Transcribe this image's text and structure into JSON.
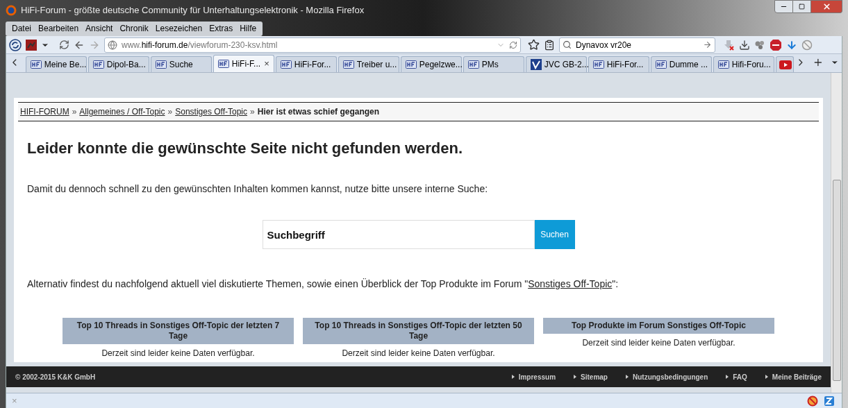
{
  "window": {
    "title": "HiFi-Forum - größte deutsche Community für Unterhaltungselektronik - Mozilla Firefox"
  },
  "menu": [
    "Datei",
    "Bearbeiten",
    "Ansicht",
    "Chronik",
    "Lesezeichen",
    "Extras",
    "Hilfe"
  ],
  "address": {
    "domain_prefix": "www.",
    "domain": "hifi-forum.de",
    "path": "/viewforum-230-ksv.html"
  },
  "search": {
    "value": "Dynavox vr20e"
  },
  "tabs": [
    {
      "label": "Meine Be...",
      "kind": "forum",
      "selected": false
    },
    {
      "label": "Dipol-Ba...",
      "kind": "forum",
      "selected": false
    },
    {
      "label": "Suche",
      "kind": "forum",
      "selected": false
    },
    {
      "label": "HiFi-F...",
      "kind": "forum",
      "selected": true,
      "close": "×"
    },
    {
      "label": "HiFi-For...",
      "kind": "forum",
      "selected": false
    },
    {
      "label": "Treiber u...",
      "kind": "forum",
      "selected": false
    },
    {
      "label": "Pegelzwe...",
      "kind": "forum",
      "selected": false
    },
    {
      "label": "PMs",
      "kind": "forum",
      "selected": false
    },
    {
      "label": "JVC GB-2...",
      "kind": "brand",
      "selected": false
    },
    {
      "label": "HiFi-For...",
      "kind": "forum",
      "selected": false
    },
    {
      "label": "Dumme ...",
      "kind": "forum",
      "selected": false
    },
    {
      "label": "Hifi-Foru...",
      "kind": "forum",
      "selected": false
    },
    {
      "kind": "video",
      "selected": false
    }
  ],
  "breadcrumb": {
    "links": [
      "HIFI-FORUM",
      "Allgemeines / Off-Topic",
      "Sonstiges Off-Topic"
    ],
    "separator": "»",
    "current": "Hier ist etwas schief gegangen"
  },
  "heading": "Leider konnte die gewünschte Seite nicht gefunden werden.",
  "intro": "Damit du dennoch schnell zu den gewünschten Inhalten kommen kannst, nutze bitte unsere interne Suche:",
  "search_form": {
    "placeholder": "Suchbegriff",
    "button": "Suchen"
  },
  "alternative": {
    "before": "Alternativ findest du nachfolgend aktuell viel diskutierte Themen, sowie einen Überblick der Top Produkte im Forum \"",
    "link": "Sonstiges Off-Topic",
    "after": "\":"
  },
  "boxes": [
    {
      "title": "Top 10 Threads in Sonstiges Off-Topic der letzten 7 Tage",
      "text": "Derzeit sind leider keine Daten verfügbar."
    },
    {
      "title": "Top 10 Threads in Sonstiges Off-Topic der letzten 50 Tage",
      "text": "Derzeit sind leider keine Daten verfügbar."
    },
    {
      "title": "Top Produkte im Forum Sonstiges Off-Topic",
      "text": "Derzeit sind leider keine Daten verfügbar."
    }
  ],
  "footer": {
    "copyright": "© 2002-2015 K&K GmbH",
    "links": [
      "Impressum",
      "Sitemap",
      "Nutzungsbedingungen",
      "FAQ",
      "Meine Beiträge"
    ]
  },
  "status_bar": {
    "close": "×"
  }
}
